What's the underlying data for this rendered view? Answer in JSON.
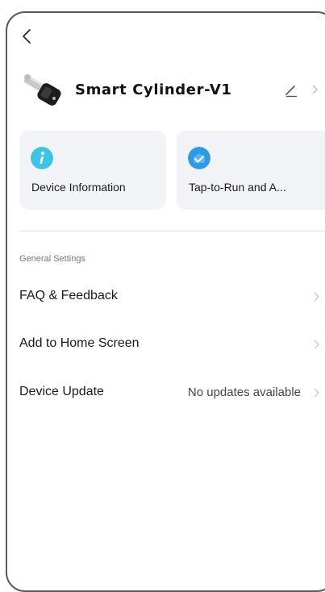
{
  "device": {
    "name": "Smart Cylinder-V1"
  },
  "cards": [
    {
      "label": "Device Information",
      "icon": "info-icon",
      "color": "#3bc4e6"
    },
    {
      "label": "Tap-to-Run and A...",
      "icon": "check-badge-icon",
      "color": "#2b9be8"
    }
  ],
  "general_settings": {
    "title": "General Settings",
    "items": [
      {
        "label": "FAQ & Feedback",
        "value": ""
      },
      {
        "label": "Add to Home Screen",
        "value": ""
      },
      {
        "label": "Device Update",
        "value": "No updates available"
      }
    ]
  }
}
